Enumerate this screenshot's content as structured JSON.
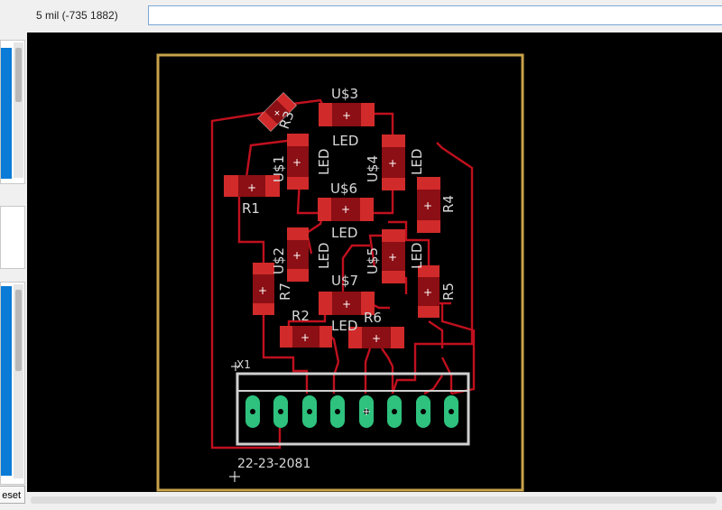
{
  "toolbar": {
    "grid_status": "5 mil (-735 1882)",
    "command_value": "",
    "command_placeholder": ""
  },
  "left_panel": {
    "reset_label": "eset"
  },
  "board": {
    "outline_color": "#c8a24a",
    "trace_color": "#c0101e",
    "pad_color": "#d12a2a",
    "connector_pad_color": "#2ec27e",
    "silkscreen_color": "#d0d0d0"
  },
  "components": {
    "r1": "R1",
    "r2": "R2",
    "r3": "R3",
    "r4": "R4",
    "r5": "R5",
    "r6": "R6",
    "r7": "R7",
    "u1": "U$1",
    "u2": "U$2",
    "u3": "U$3",
    "u4": "U$4",
    "u5": "U$5",
    "u6": "U$6",
    "u7": "U$7",
    "led": "LED",
    "x1": "X1",
    "x1_value": "22-23-2081"
  }
}
